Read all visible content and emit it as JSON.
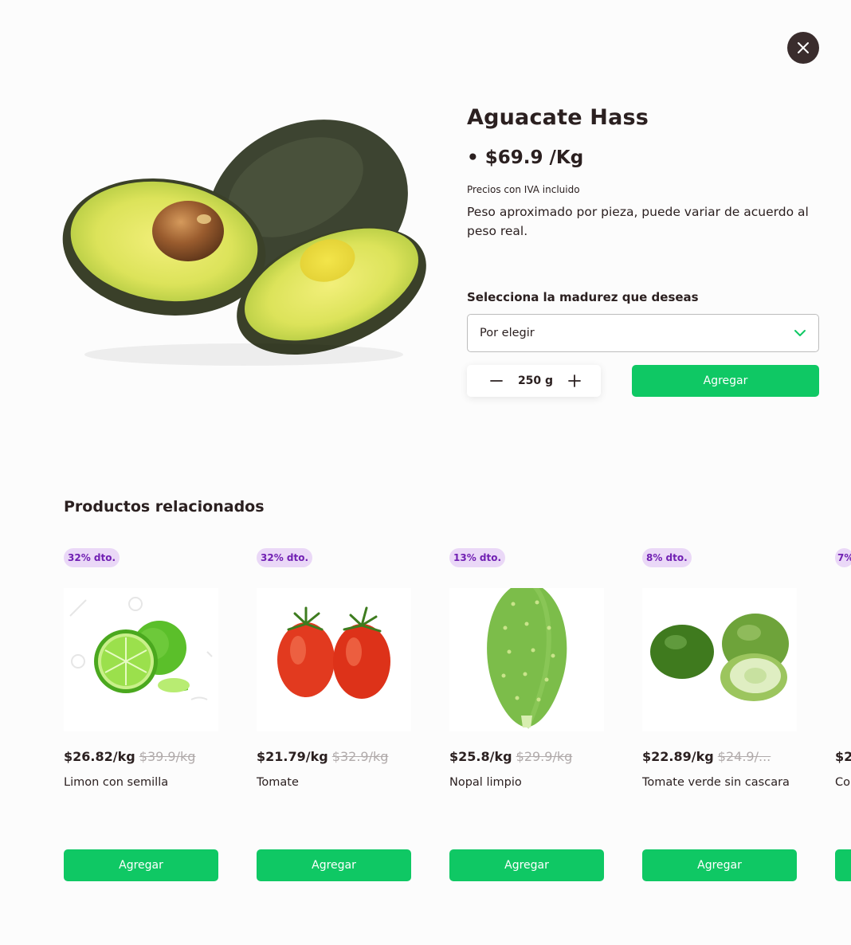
{
  "product": {
    "title": "Aguacate Hass",
    "price": "• $69.9 /Kg",
    "iva_note": "Precios con IVA incluido",
    "description": "Peso aproximado por pieza, puede variar de acuerdo al peso real.",
    "ripeness_label": "Selecciona la madurez que deseas",
    "ripeness_value": "Por elegir",
    "quantity": "250 g",
    "add_label": "Agregar"
  },
  "related": {
    "title": "Productos relacionados",
    "items": [
      {
        "badge": "32% dto.",
        "price": "$26.82/kg",
        "old_price": "$39.9/kg",
        "name": "Limon con semilla",
        "add_label": "Agregar"
      },
      {
        "badge": "32% dto.",
        "price": "$21.79/kg",
        "old_price": "$32.9/kg",
        "name": "Tomate",
        "add_label": "Agregar"
      },
      {
        "badge": "13% dto.",
        "price": "$25.8/kg",
        "old_price": "$29.9/kg",
        "name": "Nopal limpio",
        "add_label": "Agregar"
      },
      {
        "badge": "8% dto.",
        "price": "$22.89/kg",
        "old_price": "$24.9/...",
        "name": "Tomate verde sin cascara",
        "add_label": "Agregar"
      },
      {
        "badge": "7%",
        "price": "$2",
        "old_price": "",
        "name": "Co",
        "add_label": ""
      }
    ]
  },
  "colors": {
    "accent": "#0fc864",
    "badge_bg": "#ead8f7",
    "badge_text": "#7120b3",
    "close_bg": "#3a2d2d"
  },
  "icons": [
    "close-icon",
    "chevron-down-icon",
    "minus-icon",
    "plus-icon"
  ]
}
